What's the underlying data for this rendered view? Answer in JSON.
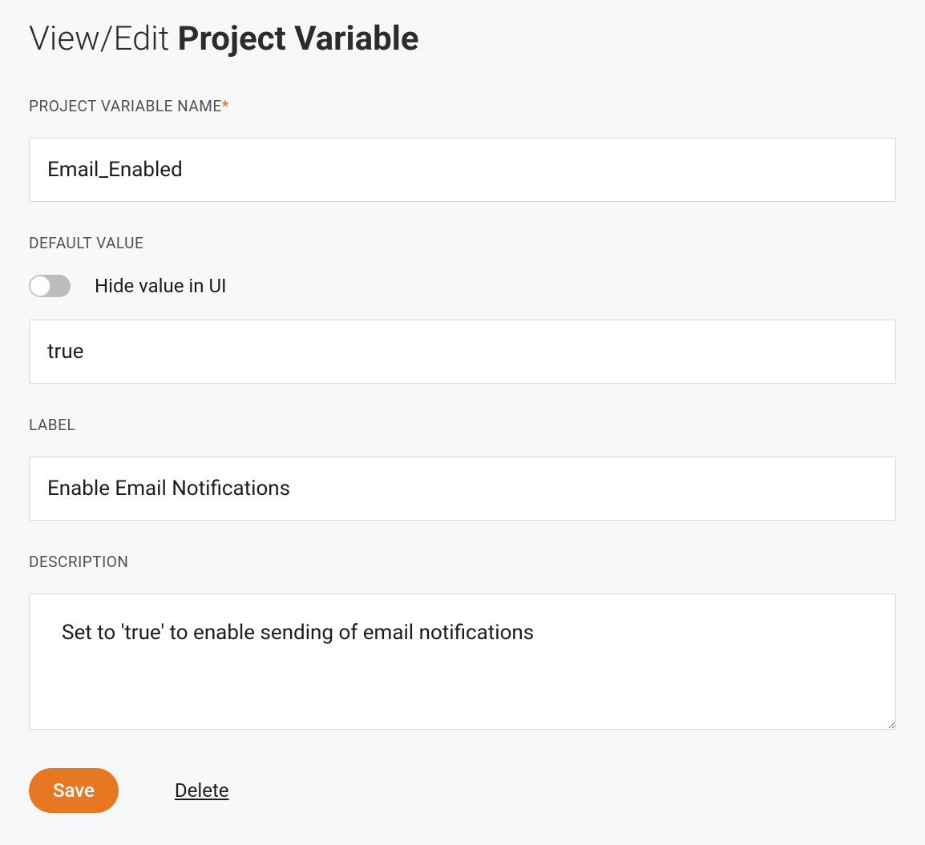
{
  "header": {
    "title_prefix": "View/Edit ",
    "title_bold": "Project Variable"
  },
  "form": {
    "name": {
      "label": "PROJECT VARIABLE NAME",
      "required_marker": "*",
      "value": "Email_Enabled"
    },
    "default_value": {
      "label": "DEFAULT VALUE",
      "hide_toggle_label": "Hide value in UI",
      "hide_toggle_on": false,
      "value": "true"
    },
    "label_field": {
      "label": "LABEL",
      "value": "Enable Email Notifications"
    },
    "description": {
      "label": "DESCRIPTION",
      "value": "Set to 'true' to enable sending of email notifications"
    }
  },
  "actions": {
    "save": "Save",
    "delete": "Delete"
  }
}
